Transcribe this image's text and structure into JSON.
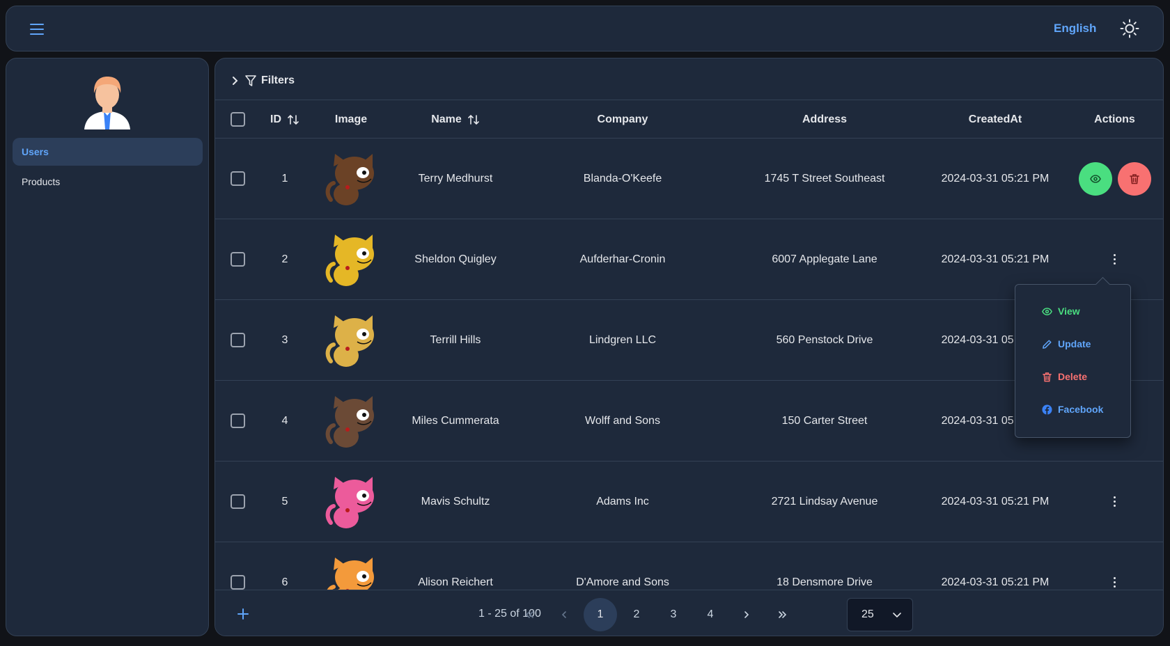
{
  "header": {
    "language": "English"
  },
  "sidebar": {
    "items": [
      {
        "label": "Users"
      },
      {
        "label": "Products"
      }
    ]
  },
  "main": {
    "filters_label": "Filters",
    "columns": {
      "id": "ID",
      "image": "Image",
      "name": "Name",
      "company": "Company",
      "address": "Address",
      "created_at": "CreatedAt",
      "actions": "Actions"
    },
    "rows": [
      {
        "id": "1",
        "name": "Terry Medhurst",
        "company": "Blanda-O'Keefe",
        "address": "1745 T Street Southeast",
        "created_at": "2024-03-31 05:21 PM",
        "cat_color": "#6b4226"
      },
      {
        "id": "2",
        "name": "Sheldon Quigley",
        "company": "Aufderhar-Cronin",
        "address": "6007 Applegate Lane",
        "created_at": "2024-03-31 05:21 PM",
        "cat_color": "#e5b726"
      },
      {
        "id": "3",
        "name": "Terrill Hills",
        "company": "Lindgren LLC",
        "address": "560 Penstock Drive",
        "created_at": "2024-03-31 05:21 PM",
        "cat_color": "#ddb148"
      },
      {
        "id": "4",
        "name": "Miles Cummerata",
        "company": "Wolff and Sons",
        "address": "150 Carter Street",
        "created_at": "2024-03-31 05:21 PM",
        "cat_color": "#6b4a36"
      },
      {
        "id": "5",
        "name": "Mavis Schultz",
        "company": "Adams Inc",
        "address": "2721 Lindsay Avenue",
        "created_at": "2024-03-31 05:21 PM",
        "cat_color": "#ec5b9b"
      },
      {
        "id": "6",
        "name": "Alison Reichert",
        "company": "D'Amore and Sons",
        "address": "18 Densmore Drive",
        "created_at": "2024-03-31 05:21 PM",
        "cat_color": "#f39a3b"
      }
    ],
    "row_menu": {
      "view": "View",
      "update": "Update",
      "delete": "Delete",
      "facebook": "Facebook"
    }
  },
  "footer": {
    "range": "1 - 25 of 100",
    "pages": [
      "1",
      "2",
      "3",
      "4"
    ],
    "per_page": "25"
  },
  "colors": {
    "accent": "#60a5fa",
    "success": "#4ade80",
    "danger": "#f87171"
  }
}
